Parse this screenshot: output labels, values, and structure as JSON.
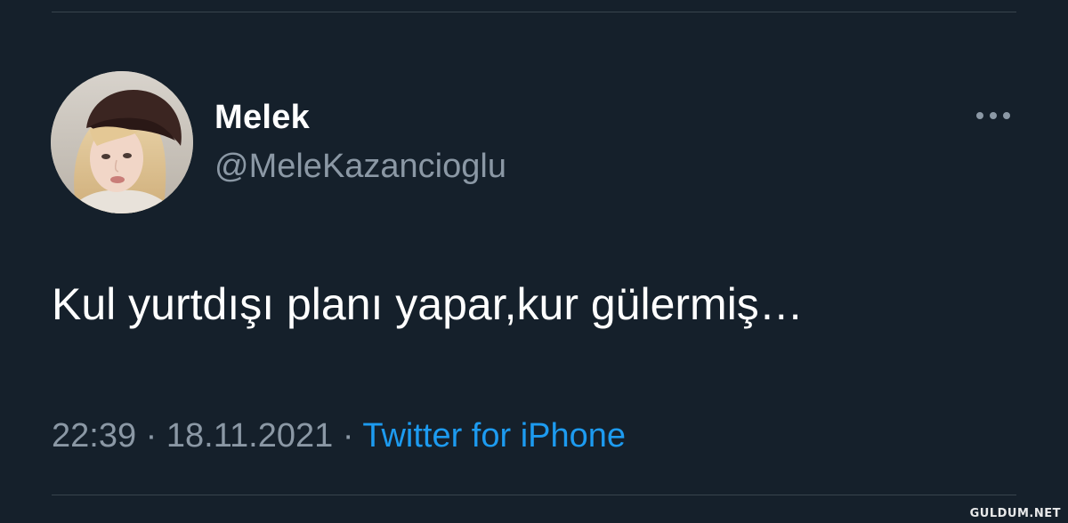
{
  "tweet": {
    "author": {
      "display_name": "Melek",
      "handle": "@MeleKazancioglu",
      "avatar": "profile-photo"
    },
    "text": "Kul yurtdışı planı yapar,kur gülermiş…",
    "time": "22:39",
    "separator": "·",
    "date": "18.11.2021",
    "source": "Twitter for iPhone",
    "more_icon": "more-horizontal-icon"
  },
  "watermark": "GULDUM.NET",
  "colors": {
    "background": "#15202b",
    "primary_text": "#ffffff",
    "secondary_text": "#8b98a5",
    "link": "#1d9bf0",
    "divider": "#38444d"
  }
}
